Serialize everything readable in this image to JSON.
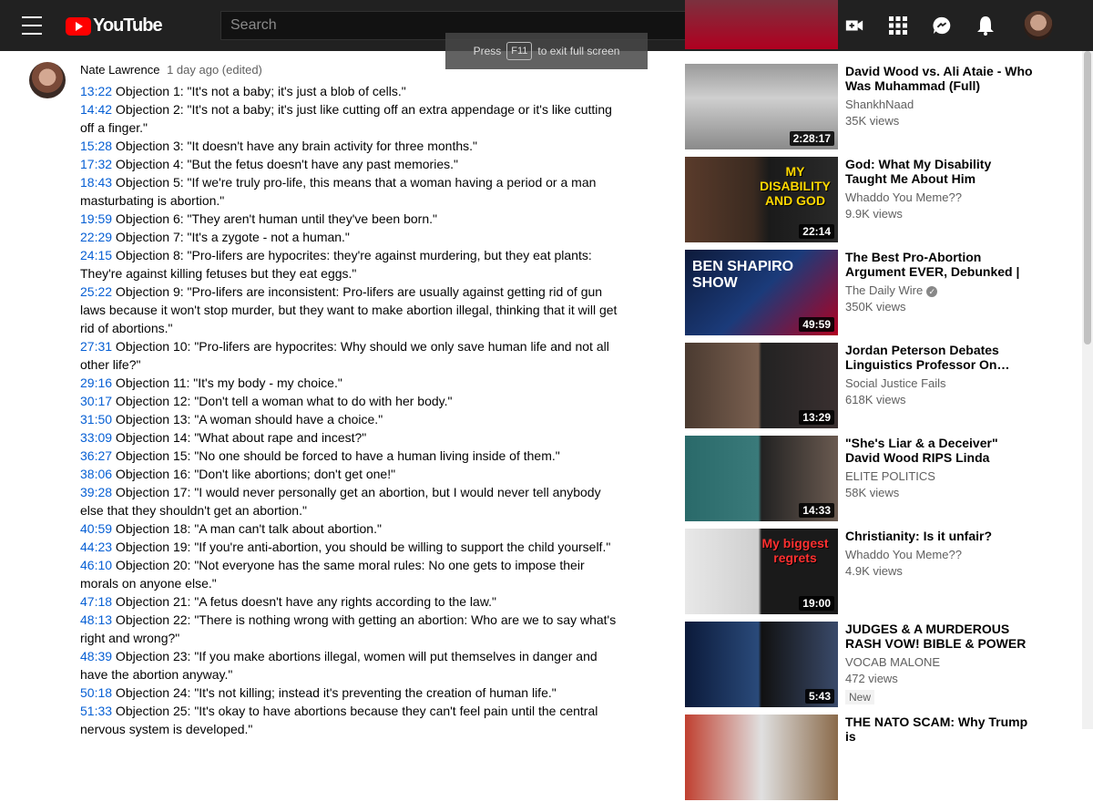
{
  "header": {
    "logo_text": "YouTube",
    "search_placeholder": "Search",
    "icons": [
      "menu-icon",
      "search-icon",
      "create-video-icon",
      "apps-grid-icon",
      "messages-icon",
      "notifications-bell-icon"
    ]
  },
  "toast": {
    "prefix": "Press",
    "key": "F11",
    "suffix": "to exit full screen"
  },
  "comment": {
    "author": "Nate Lawrence",
    "time": "1 day ago (edited)",
    "lines": [
      {
        "ts": "13:22",
        "text": " Objection 1: \"It's not a baby; it's just a blob of cells.\""
      },
      {
        "ts": "14:42",
        "text": " Objection 2: \"It's not a baby; it's just like cutting off an extra appendage or it's like cutting off a finger.\""
      },
      {
        "ts": "15:28",
        "text": " Objection 3: \"It doesn't have any brain activity for three months.\""
      },
      {
        "ts": "17:32",
        "text": " Objection 4: \"But the fetus doesn't have any past memories.\""
      },
      {
        "ts": "18:43",
        "text": " Objection 5: \"If we're truly pro-life, this means that a woman having a period or a man masturbating is abortion.\""
      },
      {
        "ts": "19:59",
        "text": " Objection 6: \"They aren't human until they've been born.\""
      },
      {
        "ts": "22:29",
        "text": " Objection 7: \"It's a zygote - not a human.\""
      },
      {
        "ts": "24:15",
        "text": " Objection 8: \"Pro-lifers are hypocrites: they're against murdering, but they eat plants: They're against killing fetuses but they eat eggs.\""
      },
      {
        "ts": "25:22",
        "text": " Objection 9: \"Pro-lifers are inconsistent: Pro-lifers are usually against getting rid of gun laws because it won't stop murder, but they want to make abortion illegal, thinking that it will get rid of abortions.\""
      },
      {
        "ts": "27:31",
        "text": " Objection 10: \"Pro-lifers are hypocrites: Why should we only save human life and not all other life?\""
      },
      {
        "ts": "29:16",
        "text": " Objection 11: \"It's my body - my choice.\""
      },
      {
        "ts": "30:17",
        "text": " Objection 12: \"Don't tell a woman what to do with her body.\""
      },
      {
        "ts": "31:50",
        "text": " Objection 13: \"A woman should have a choice.\""
      },
      {
        "ts": "33:09",
        "text": " Objection 14: \"What about rape and incest?\""
      },
      {
        "ts": "36:27",
        "text": " Objection 15: \"No one should be forced to have a human living inside of them.\""
      },
      {
        "ts": "38:06",
        "text": " Objection 16: \"Don't like abortions; don't get one!\""
      },
      {
        "ts": "39:28",
        "text": " Objection 17: \"I would never personally get an abortion, but I would never tell anybody else that they shouldn't get an abortion.\""
      },
      {
        "ts": "40:59",
        "text": " Objection 18: \"A man can't talk about abortion.\""
      },
      {
        "ts": "44:23",
        "text": " Objection 19: \"If you're anti-abortion, you should be willing to support the child yourself.\""
      },
      {
        "ts": "46:10",
        "text": " Objection 20: \"Not everyone has the same moral rules: No one gets to impose their morals on anyone else.\""
      },
      {
        "ts": "47:18",
        "text": " Objection 21: \"A fetus doesn't have any rights according to the law.\""
      },
      {
        "ts": "48:13",
        "text": " Objection 22: \"There is nothing wrong with getting an abortion: Who are we to say what's right and wrong?\""
      },
      {
        "ts": "48:39",
        "text": " Objection 23: \"If you make abortions illegal, women will put themselves in danger and have the abortion anyway.\""
      },
      {
        "ts": "50:18",
        "text": " Objection 24: \"It's not killing; instead it's preventing the creation of human life.\""
      },
      {
        "ts": "51:33",
        "text": " Objection 25: \"It's okay to have abortions because they can't feel pain until the central nervous system is developed.\""
      }
    ]
  },
  "recommendations": [
    {
      "title": "David Wood vs. Ali Ataie - Who Was Muhammad (Full)",
      "channel": "ShankhNaad",
      "views": "35K views",
      "duration": "2:28:17",
      "verified": false,
      "new": false
    },
    {
      "title": "God: What My Disability Taught Me About Him",
      "channel": "Whaddo You Meme??",
      "views": "9.9K views",
      "duration": "22:14",
      "verified": false,
      "new": false,
      "thumb_text": "MY DISABILITY AND GOD"
    },
    {
      "title": "The Best Pro-Abortion Argument EVER, Debunked | …",
      "channel": "The Daily Wire",
      "views": "350K views",
      "duration": "49:59",
      "verified": true,
      "new": false,
      "thumb_text": "BEN SHAPIRO SHOW"
    },
    {
      "title": "Jordan Peterson Debates Linguistics Professor On…",
      "channel": "Social Justice Fails",
      "views": "618K views",
      "duration": "13:29",
      "verified": false,
      "new": false
    },
    {
      "title": "\"She's Liar & a Deceiver\" David Wood RIPS Linda Sarsour apar…",
      "channel": "ELITE POLITICS",
      "views": "58K views",
      "duration": "14:33",
      "verified": false,
      "new": false
    },
    {
      "title": "Christianity: Is it unfair?",
      "channel": "Whaddo You Meme??",
      "views": "4.9K views",
      "duration": "19:00",
      "verified": false,
      "new": false,
      "thumb_text": "My biggest regrets"
    },
    {
      "title": "JUDGES & A MURDEROUS RASH VOW! BIBLE & POWER O…",
      "channel": "VOCAB MALONE",
      "views": "472 views",
      "duration": "5:43",
      "verified": false,
      "new": true,
      "new_label": "New"
    },
    {
      "title": "THE NATO SCAM: Why Trump is",
      "channel": "",
      "views": "",
      "duration": "",
      "verified": false,
      "new": false
    }
  ],
  "colors": {
    "topbar": "#212121",
    "link": "#065fd4",
    "accent": "#ff0000"
  }
}
